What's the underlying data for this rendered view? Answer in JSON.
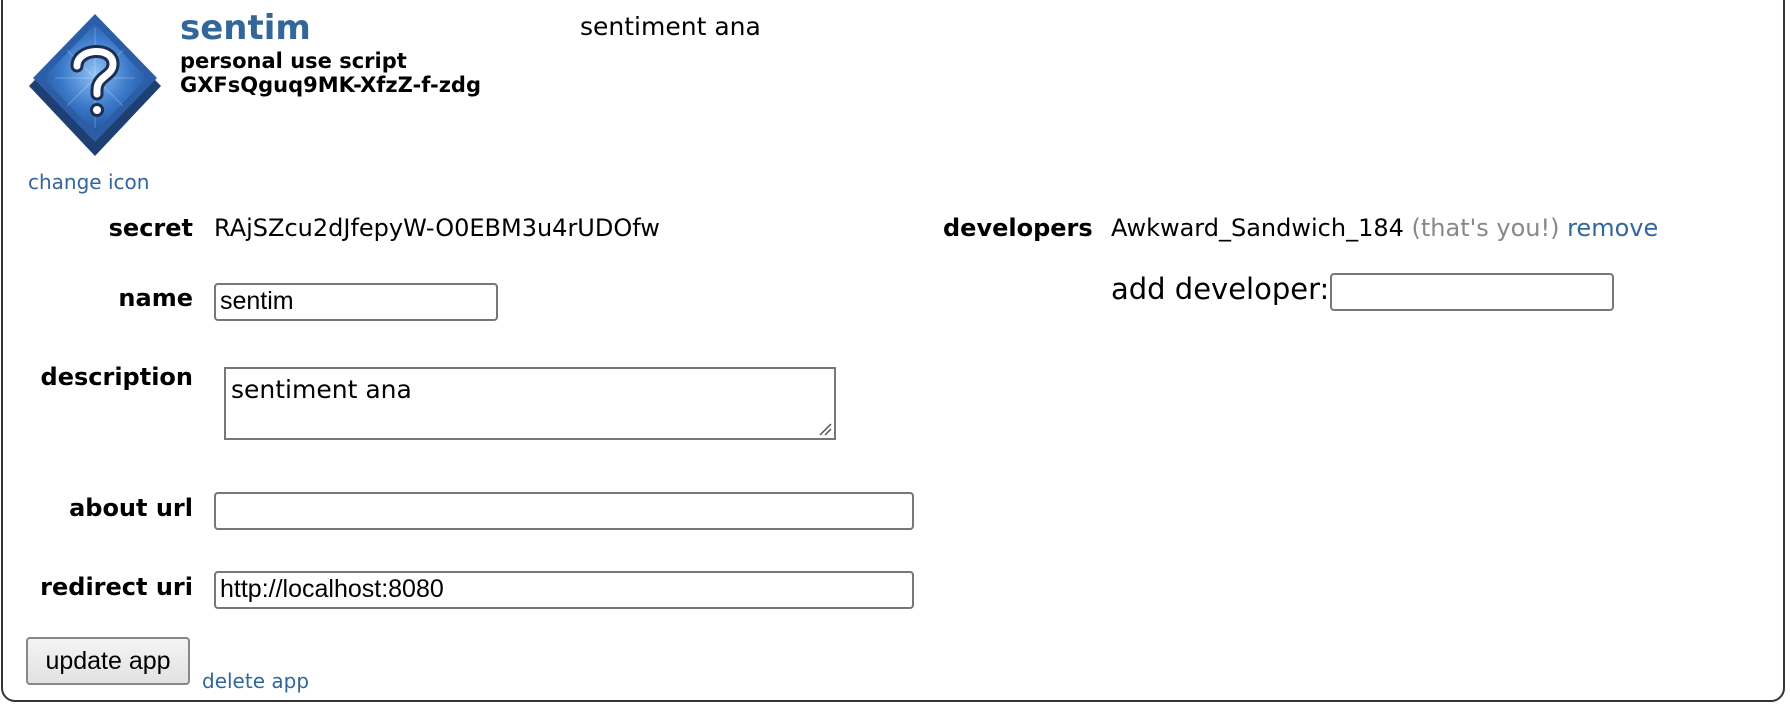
{
  "app": {
    "name": "sentim",
    "type": "personal use script",
    "client_id": "GXFsQguq9MK-XfzZ-f-zdg",
    "description_display": "sentiment ana",
    "change_icon_label": "change icon"
  },
  "form": {
    "secret_label": "secret",
    "secret_value": "RAjSZcu2dJfepyW-O0EBM3u4rUDOfw",
    "name_label": "name",
    "name_value": "sentim",
    "description_label": "description",
    "description_value": "sentiment ana",
    "about_url_label": "about url",
    "about_url_value": "",
    "redirect_uri_label": "redirect uri",
    "redirect_uri_value": "http://localhost:8080",
    "update_button_label": "update app",
    "delete_link_label": "delete app"
  },
  "developers": {
    "label": "developers",
    "username": "Awkward_Sandwich_184",
    "you_note": "(that's you!)",
    "remove_label": "remove",
    "add_label": "add developer:",
    "add_value": ""
  },
  "colors": {
    "link": "#336699",
    "muted": "#888888",
    "icon_blue": "#3a78c9"
  },
  "icons": {
    "app_icon": "question-mark-diamond-icon",
    "resize_grip": "resize-grip-icon"
  }
}
